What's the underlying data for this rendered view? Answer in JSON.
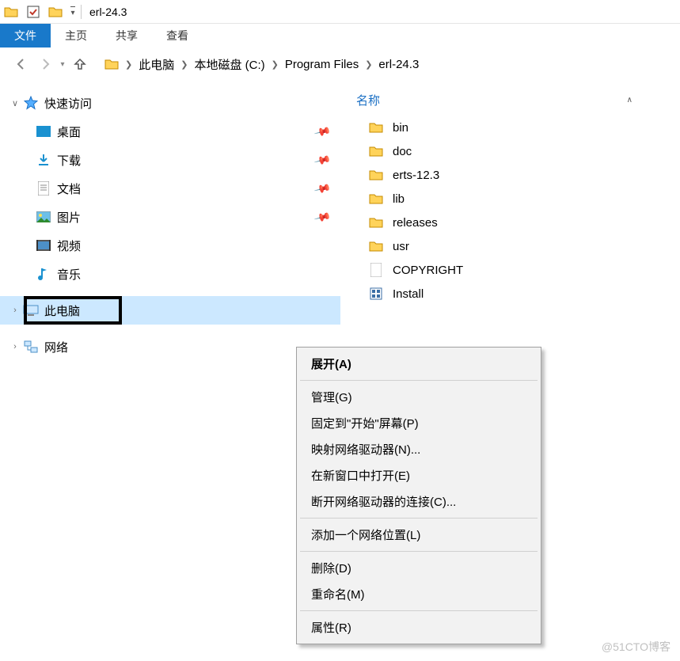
{
  "title": "erl-24.3",
  "ribbon": {
    "file": "文件",
    "home": "主页",
    "share": "共享",
    "view": "查看"
  },
  "breadcrumb": [
    "此电脑",
    "本地磁盘 (C:)",
    "Program Files",
    "erl-24.3"
  ],
  "sidebar": {
    "quick_access": "快速访问",
    "items": [
      {
        "label": "桌面"
      },
      {
        "label": "下载"
      },
      {
        "label": "文档"
      },
      {
        "label": "图片"
      },
      {
        "label": "视频"
      },
      {
        "label": "音乐"
      }
    ],
    "this_pc": "此电脑",
    "network": "网络"
  },
  "content": {
    "column_name": "名称",
    "items": [
      {
        "type": "folder",
        "name": "bin"
      },
      {
        "type": "folder",
        "name": "doc"
      },
      {
        "type": "folder",
        "name": "erts-12.3"
      },
      {
        "type": "folder",
        "name": "lib"
      },
      {
        "type": "folder",
        "name": "releases"
      },
      {
        "type": "folder",
        "name": "usr"
      },
      {
        "type": "file",
        "name": "COPYRIGHT"
      },
      {
        "type": "exe",
        "name": "Install"
      }
    ]
  },
  "context_menu": {
    "expand": "展开(A)",
    "manage": "管理(G)",
    "pin_start": "固定到\"开始\"屏幕(P)",
    "map_drive": "映射网络驱动器(N)...",
    "open_new": "在新窗口中打开(E)",
    "disconnect": "断开网络驱动器的连接(C)...",
    "add_location": "添加一个网络位置(L)",
    "delete": "删除(D)",
    "rename": "重命名(M)",
    "properties": "属性(R)"
  },
  "watermark": "@51CTO博客"
}
